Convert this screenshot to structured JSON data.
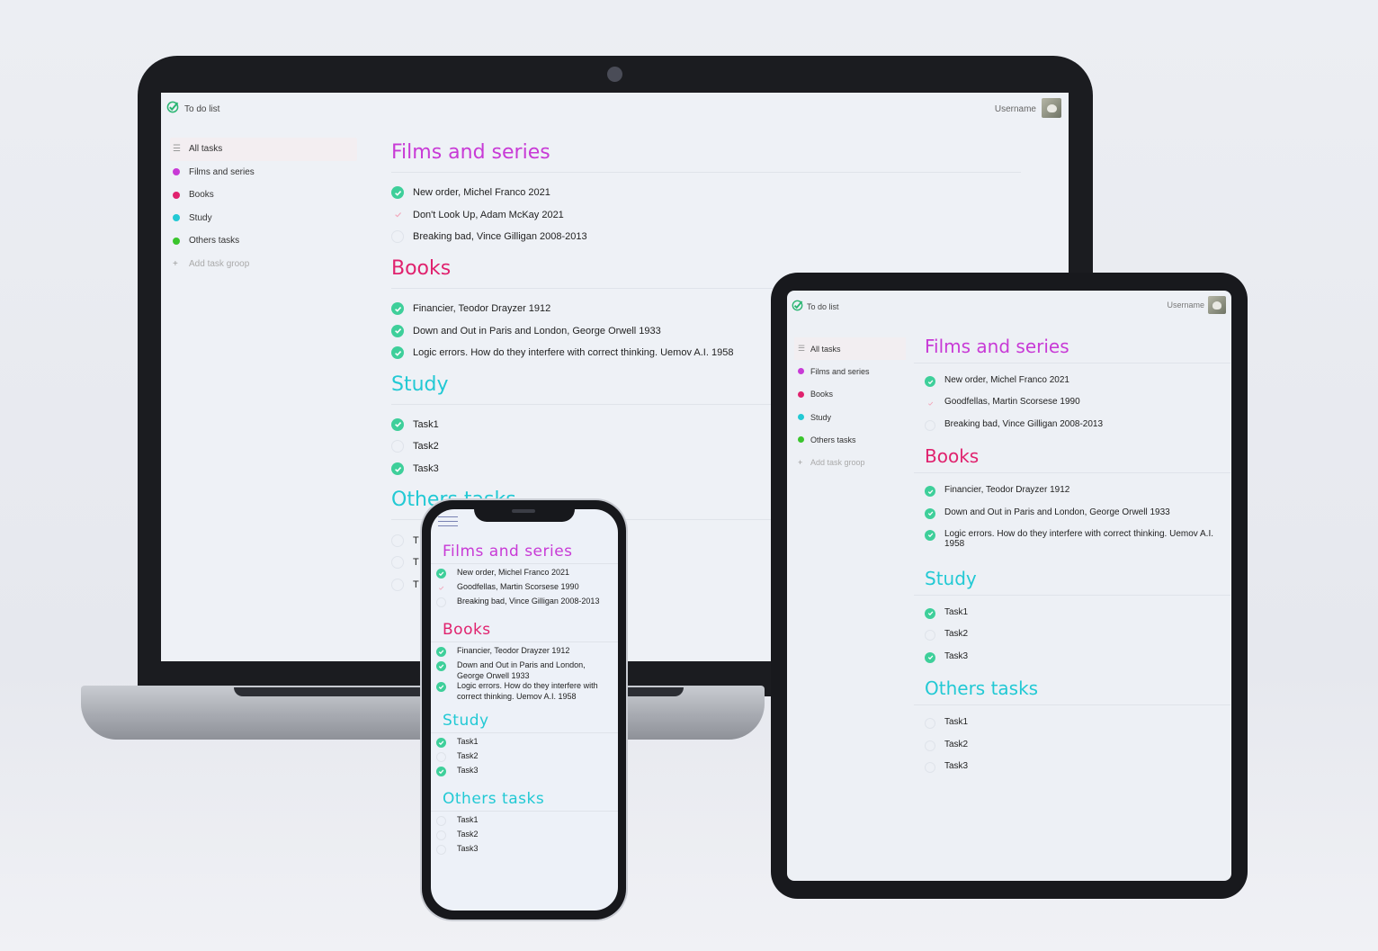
{
  "colors": {
    "films": "#c83ad6",
    "books": "#e0226e",
    "study": "#22c9d4",
    "others": "#3ac52d",
    "check": "#3ecf9a"
  },
  "laptop": {
    "app_title": "To do list",
    "username": "Username",
    "sidebar": {
      "items": [
        {
          "label": "All tasks",
          "icon": "list-icon"
        },
        {
          "label": "Films and series",
          "dot": "films"
        },
        {
          "label": "Books",
          "dot": "books"
        },
        {
          "label": "Study",
          "dot": "study"
        },
        {
          "label": "Others tasks",
          "dot": "others"
        }
      ],
      "add_label": "Add task groop"
    },
    "sections": [
      {
        "title": "Films and series",
        "tasks": [
          {
            "text": "New order, Michel Franco 2021",
            "state": "done"
          },
          {
            "text": "Don't Look Up,  Adam McKay 2021",
            "state": "partial"
          },
          {
            "text": "Breaking bad, Vince Gilligan 2008-2013",
            "state": "empty"
          }
        ]
      },
      {
        "title": "Books",
        "tasks": [
          {
            "text": "Financier, Teodor Drayzer 1912",
            "state": "done"
          },
          {
            "text": "Down and Out in Paris and London,  George Orwell 1933",
            "state": "done"
          },
          {
            "text": "Logic errors. How do they interfere with correct thinking. Uemov A.I. 1958",
            "state": "done"
          }
        ]
      },
      {
        "title": "Study",
        "tasks": [
          {
            "text": "Task1",
            "state": "done"
          },
          {
            "text": "Task2",
            "state": "empty"
          },
          {
            "text": "Task3",
            "state": "done"
          }
        ]
      },
      {
        "title": "Others tasks",
        "tasks": [
          {
            "text": "T",
            "state": "empty"
          },
          {
            "text": "T",
            "state": "empty"
          },
          {
            "text": "T",
            "state": "empty"
          }
        ]
      }
    ]
  },
  "tablet": {
    "app_title": "To do list",
    "username": "Username",
    "sidebar": {
      "items": [
        {
          "label": "All tasks",
          "icon": "list-icon"
        },
        {
          "label": "Films and series",
          "dot": "films"
        },
        {
          "label": "Books",
          "dot": "books"
        },
        {
          "label": "Study",
          "dot": "study"
        },
        {
          "label": "Others tasks",
          "dot": "others"
        }
      ],
      "add_label": "Add task groop"
    },
    "sections": [
      {
        "title": "Films and series",
        "tasks": [
          {
            "text": "New order, Michel Franco 2021",
            "state": "done"
          },
          {
            "text": "Goodfellas, Martin Scorsese 1990",
            "state": "partial"
          },
          {
            "text": "Breaking bad, Vince Gilligan 2008-2013",
            "state": "empty"
          }
        ]
      },
      {
        "title": "Books",
        "tasks": [
          {
            "text": "Financier, Teodor Drayzer 1912",
            "state": "done"
          },
          {
            "text": "Down and Out in Paris and London,  George Orwell 1933",
            "state": "done"
          },
          {
            "text": "Logic errors. How do they interfere with correct thinking. Uemov A.I. 1958",
            "state": "done"
          }
        ]
      },
      {
        "title": "Study",
        "tasks": [
          {
            "text": "Task1",
            "state": "done"
          },
          {
            "text": "Task2",
            "state": "empty"
          },
          {
            "text": "Task3",
            "state": "done"
          }
        ]
      },
      {
        "title": "Others tasks",
        "tasks": [
          {
            "text": "Task1",
            "state": "empty"
          },
          {
            "text": "Task2",
            "state": "empty"
          },
          {
            "text": "Task3",
            "state": "empty"
          }
        ]
      }
    ]
  },
  "phone": {
    "sections": [
      {
        "title": "Films and series",
        "tasks": [
          {
            "text": "New order, Michel Franco 2021",
            "state": "done"
          },
          {
            "text": "Goodfellas, Martin Scorsese 1990",
            "state": "partial"
          },
          {
            "text": "Breaking bad, Vince Gilligan 2008-2013",
            "state": "empty"
          }
        ]
      },
      {
        "title": "Books",
        "tasks": [
          {
            "text": "Financier, Teodor Drayzer 1912",
            "state": "done"
          },
          {
            "text": "Down and Out in Paris and London,  George Orwell 1933",
            "state": "done"
          },
          {
            "text": "Logic errors. How do they interfere with correct thinking. Uemov A.I. 1958",
            "state": "done"
          }
        ]
      },
      {
        "title": "Study",
        "tasks": [
          {
            "text": "Task1",
            "state": "done"
          },
          {
            "text": "Task2",
            "state": "empty"
          },
          {
            "text": "Task3",
            "state": "done"
          }
        ]
      },
      {
        "title": "Others tasks",
        "tasks": [
          {
            "text": "Task1",
            "state": "empty"
          },
          {
            "text": "Task2",
            "state": "empty"
          },
          {
            "text": "Task3",
            "state": "empty"
          }
        ]
      }
    ]
  }
}
